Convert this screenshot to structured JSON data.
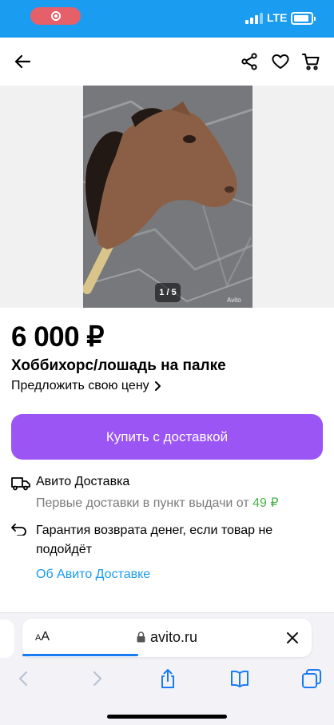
{
  "status_bar": {
    "network": "LTE",
    "bg_color": "#1a9cf0",
    "record_color": "#e6606a"
  },
  "nav": {
    "back_icon": "arrow-left-icon",
    "share_icon": "share-icon",
    "favorite_icon": "heart-icon",
    "cart_icon": "cart-icon"
  },
  "gallery": {
    "counter": "1 / 5",
    "watermark": "Avito"
  },
  "listing": {
    "price": "6 000 ₽",
    "title": "Хоббихорс/лошадь на палке",
    "offer_price_label": "Предложить свою цену",
    "buy_button_label": "Купить с доставкой",
    "accent_color": "#9b55f5"
  },
  "delivery": {
    "title": "Авито Доставка",
    "subtitle": "Первые доставки в пункт выдачи от",
    "price": "49 ₽",
    "guarantee": "Гарантия возврата денег, если товар не подойдёт",
    "about_link": "Об Авито Доставке"
  },
  "browser": {
    "text_size_label_small": "A",
    "text_size_label_large": "A",
    "url": "avito.ru",
    "icons": [
      "back-icon",
      "forward-icon",
      "share-icon",
      "bookmarks-icon",
      "tabs-icon"
    ]
  }
}
